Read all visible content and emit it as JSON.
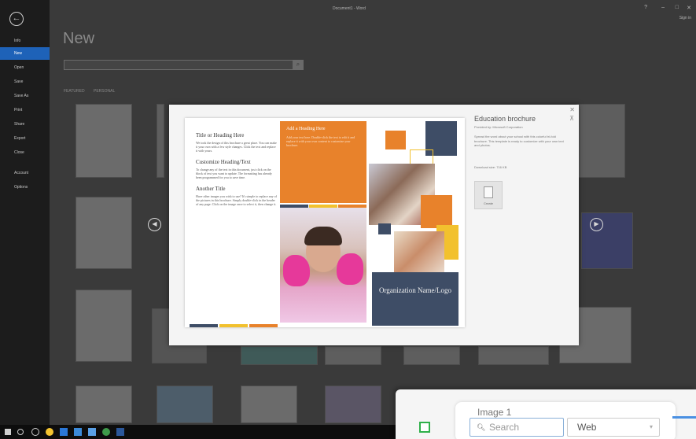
{
  "sidebar": {
    "back_icon": "back-arrow-icon",
    "items": [
      {
        "label": "Info"
      },
      {
        "label": "New",
        "active": true
      },
      {
        "label": "Open"
      },
      {
        "label": "Save"
      },
      {
        "label": "Save As"
      },
      {
        "label": "Print"
      },
      {
        "label": "Share"
      },
      {
        "label": "Export"
      },
      {
        "label": "Close"
      },
      {
        "label": "Account"
      },
      {
        "label": "Options"
      }
    ]
  },
  "window": {
    "title": "Document1 - Word",
    "user": "Sign in"
  },
  "new_page": {
    "heading": "New",
    "search_placeholder": "",
    "tabs": [
      "FEATURED",
      "PERSONAL"
    ]
  },
  "template_preview": {
    "col1": {
      "heading1": "Title or Heading Here",
      "text1": "We took the design of this brochure a great place. You can make it your own with a few style changes. Click the text and replace it with yours.",
      "heading2": "Customize Heading/Text",
      "text2": "To change any of the text in this document, just click on the block of text you want to update. The formatting has already been programmed for you to save time.",
      "heading3": "Another Title",
      "text3": "Have other images you wish to use? It's simple to replace any of the pictures in this brochure. Simply double-click in the header of any page. Click on the image once to select it, then change it."
    },
    "orange_title": "Add a Heading Here",
    "orange_text": "Add your text here. Double-click the text to edit it and replace it with your own content to customize your brochure.",
    "org_text": "Organization Name/Logo"
  },
  "template_detail": {
    "title": "Education brochure",
    "provided_by": "Provided by: Microsoft Corporation",
    "description": "Spread the word about your school with this colorful tri-fold brochure. This template is ready to customize with your own text and photos.",
    "download_size": "Download size: 716 KB",
    "create_label": "Create"
  },
  "overlay": {
    "card_title": "Image 1",
    "search_placeholder": "Search",
    "select_value": "Web"
  },
  "colors": {
    "accent": "#1e62b8",
    "orange": "#e8822b",
    "navy": "#3e4d66",
    "yellow": "#f2c12e",
    "green": "#2fb04a"
  }
}
